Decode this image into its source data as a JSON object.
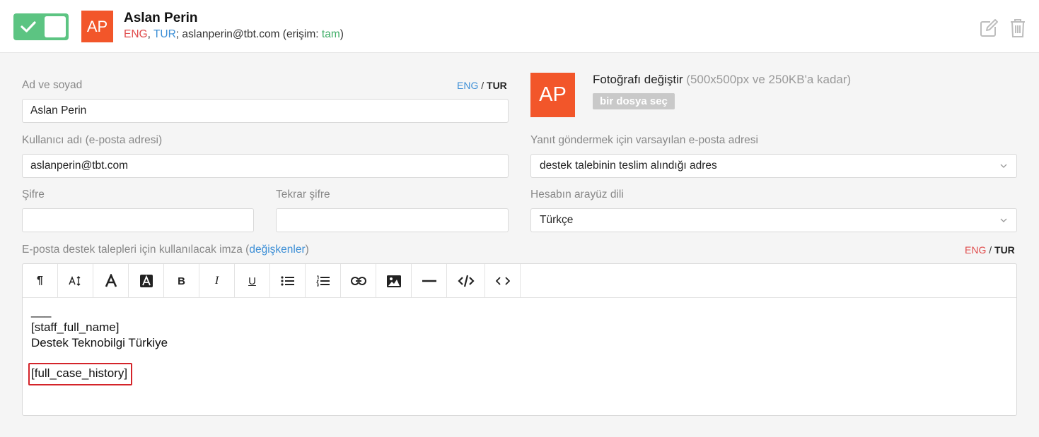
{
  "header": {
    "toggle_state": "on",
    "avatar_initials": "AP",
    "user_name": "Aslan Perin",
    "meta": {
      "lang1": "ENG",
      "comma": ",",
      "lang2": "TUR",
      "email_part": "; aslanperin@tbt.com (erişim: ",
      "access": "tam",
      "close": ")"
    }
  },
  "form": {
    "name_label": "Ad ve soyad",
    "name_lang": {
      "eng": "ENG",
      "sep": "/",
      "tur": "TUR"
    },
    "name_value": "Aslan Perin",
    "username_label": "Kullanıcı adı (e-posta adresi)",
    "username_value": "aslanperin@tbt.com",
    "password_label": "Şifre",
    "password_value": "",
    "password_repeat_label": "Tekrar şifre",
    "password_repeat_value": "",
    "photo": {
      "avatar_initials": "AP",
      "title": "Fotoğrafı değiştir",
      "hint": " (500x500px ve 250KB'a kadar)",
      "file_button": "bir dosya seç"
    },
    "reply_email_label": "Yanıt göndermek için varsayılan e-posta adresi",
    "reply_email_value": "destek talebinin teslim alındığı adres",
    "ui_lang_label": "Hesabın arayüz dili",
    "ui_lang_value": "Türkçe",
    "signature_label": "E-posta destek talepleri için kullanılacak imza (",
    "signature_link": "değişkenler",
    "signature_label_close": ")",
    "signature_lang": {
      "eng": "ENG",
      "sep": "/",
      "tur": "TUR"
    }
  },
  "editor": {
    "toolbar": [
      "paragraph-icon",
      "font-size-icon",
      "font-color-icon",
      "background-color-icon",
      "bold-icon",
      "italic-icon",
      "underline-icon",
      "bullet-list-icon",
      "numbered-list-icon",
      "link-icon",
      "image-icon",
      "horizontal-rule-icon",
      "code-view-icon",
      "html-icon"
    ],
    "toolbar_labels": {
      "bold": "B",
      "italic": "I",
      "underline": "U",
      "paragraph": "¶"
    },
    "lines": [
      "___",
      "[staff_full_name]",
      "Destek Teknobilgi Türkiye"
    ],
    "highlighted_line": "[full_case_history]"
  },
  "colors": {
    "toggle_green": "#5cc482",
    "avatar_orange": "#f2562a",
    "link_blue": "#3d8fd6",
    "eng_red": "#e04b4b",
    "access_green": "#3fae67",
    "highlight_red": "#d4242a"
  }
}
